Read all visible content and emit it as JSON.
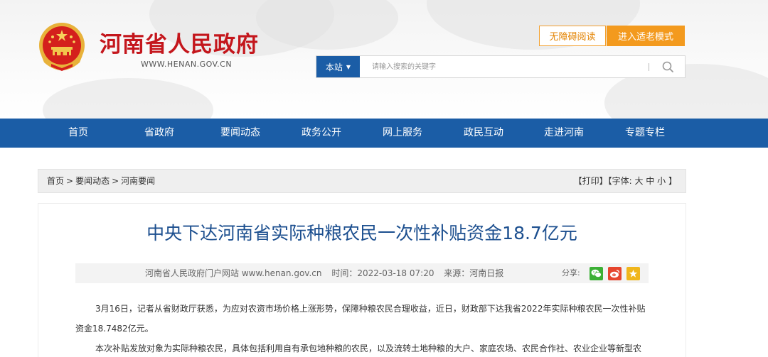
{
  "header": {
    "site_name": "河南省人民政府",
    "site_url": "WWW.HENAN.GOV.CN",
    "accessible_label": "无障碍阅读",
    "elder_mode_label": "进入适老模式"
  },
  "search": {
    "scope_label": "本站",
    "placeholder": "请输入搜索的关键字",
    "value": ""
  },
  "nav": {
    "items": [
      {
        "label": "首页"
      },
      {
        "label": "省政府"
      },
      {
        "label": "要闻动态"
      },
      {
        "label": "政务公开"
      },
      {
        "label": "网上服务"
      },
      {
        "label": "政民互动"
      },
      {
        "label": "走进河南"
      },
      {
        "label": "专题专栏"
      }
    ]
  },
  "breadcrumb": {
    "items": [
      "首页",
      "要闻动态",
      "河南要闻"
    ],
    "separator": ">"
  },
  "tools": {
    "print": "【打印】",
    "font_label": "【字体:",
    "font_large": "大",
    "font_medium": "中",
    "font_small": "小",
    "font_close": "】"
  },
  "article": {
    "title": "中央下达河南省实际种粮农民一次性补贴资金18.7亿元",
    "meta_site": "河南省人民政府门户网站 www.henan.gov.cn",
    "meta_time": "时间：2022-03-18 07:20",
    "meta_source": "来源：河南日报",
    "share_label": "分享:",
    "paragraphs": [
      "3月16日，记者从省财政厅获悉，为应对农资市场价格上涨形势，保障种粮农民合理收益，近日，财政部下达我省2022年实际种粮农民一次性补贴资金18.7482亿元。",
      "本次补贴发放对象为实际种粮农民，具体包括利用自有承包地种粮的农民，以及流转土地种粮的大户、家庭农场、农民合作社、农业企业等新型农"
    ]
  },
  "colors": {
    "brand_red": "#c4161c",
    "nav_blue": "#1b5da6",
    "title_blue": "#1c4f8f",
    "accent_orange": "#f39a1e"
  }
}
